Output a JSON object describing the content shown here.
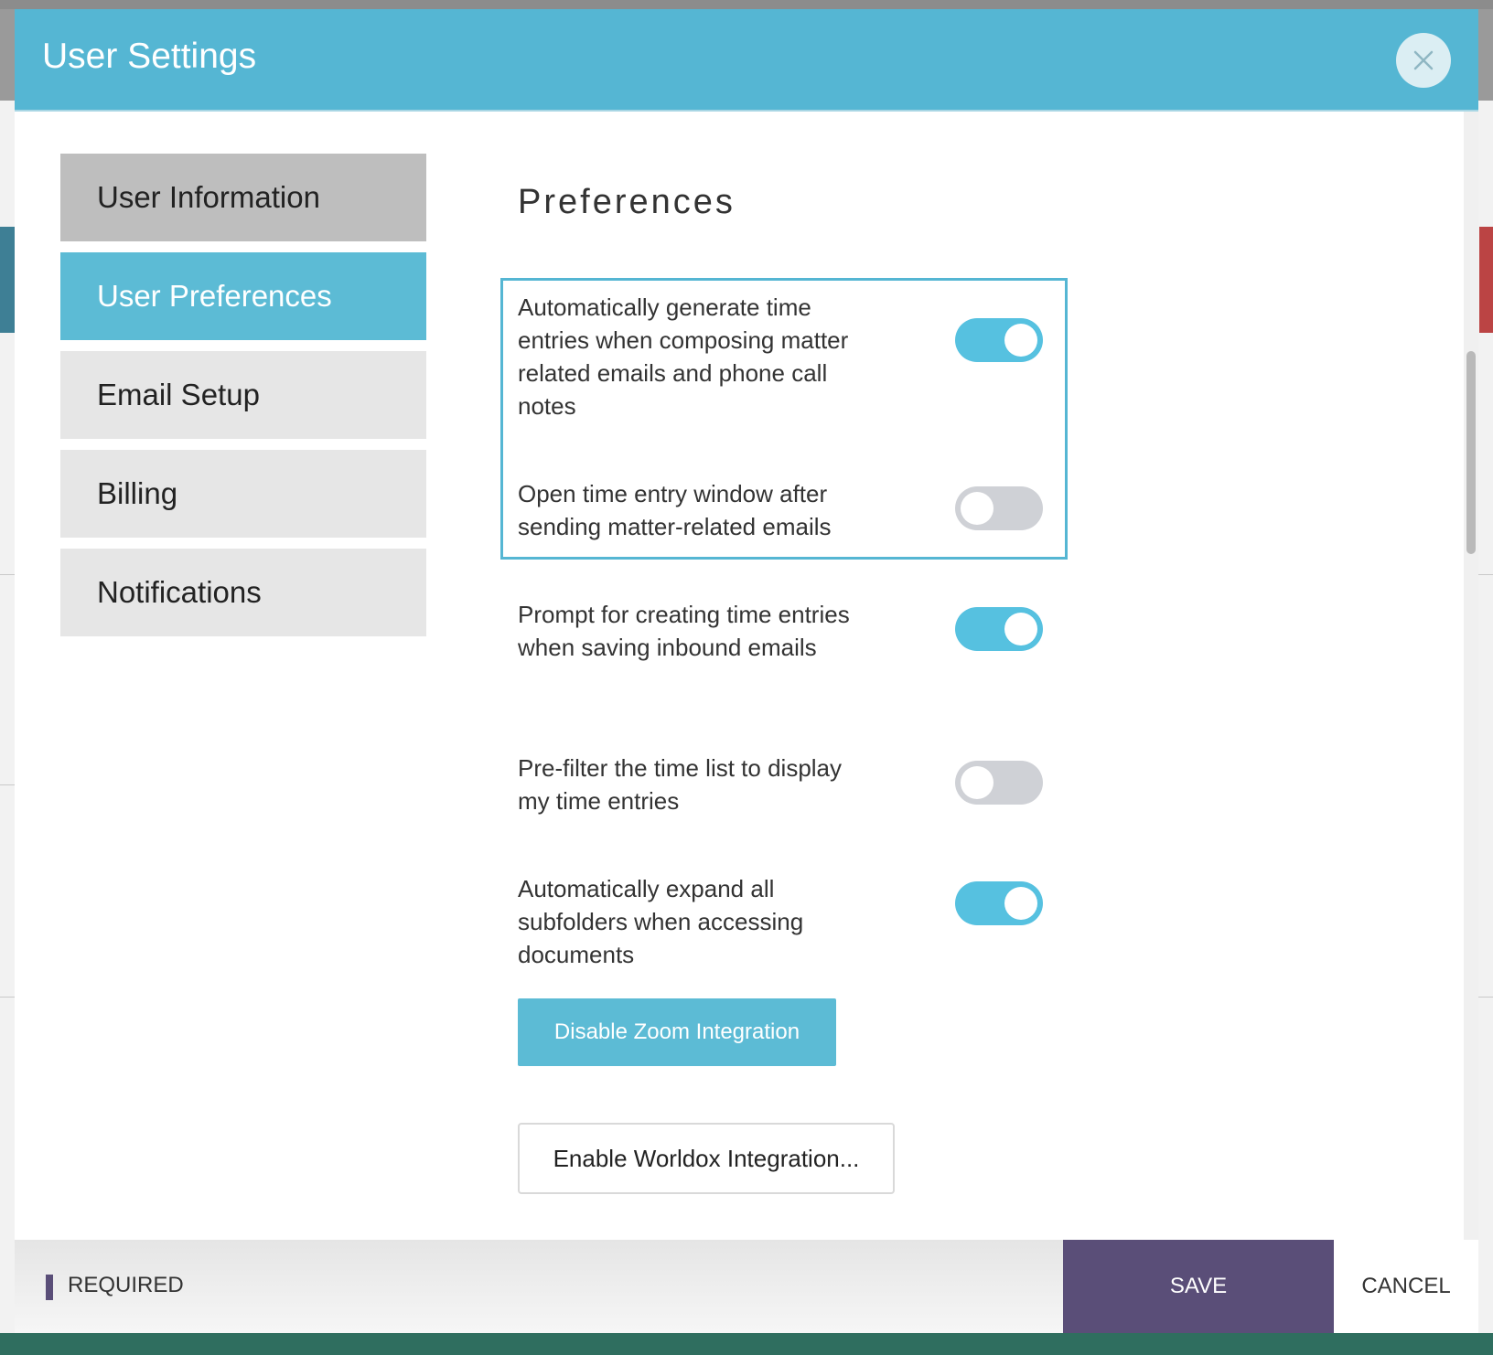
{
  "modal": {
    "title": "User Settings",
    "close_icon": "close-icon"
  },
  "sidebar": {
    "items": [
      {
        "label": "User Information",
        "state": "muted"
      },
      {
        "label": "User Preferences",
        "state": "active"
      },
      {
        "label": "Email Setup",
        "state": "default"
      },
      {
        "label": "Billing",
        "state": "default"
      },
      {
        "label": "Notifications",
        "state": "default"
      }
    ]
  },
  "content": {
    "section_title": "Preferences",
    "preferences": [
      {
        "label": "Automatically generate time entries when composing matter related emails and phone call notes",
        "enabled": true
      },
      {
        "label": "Open time entry window after sending matter-related emails",
        "enabled": false
      },
      {
        "label": "Prompt for creating time entries when saving inbound emails",
        "enabled": true
      },
      {
        "label": "Pre-filter the time list to display my time entries",
        "enabled": false
      },
      {
        "label": "Automatically expand all subfolders when accessing documents",
        "enabled": true
      }
    ],
    "zoom_button_label": "Disable Zoom Integration",
    "worldox_button_label": "Enable Worldox Integration..."
  },
  "footer": {
    "required_label": "REQUIRED",
    "save_label": "SAVE",
    "cancel_label": "CANCEL"
  },
  "colors": {
    "header": "#55b6d3",
    "active_nav": "#5cbbd5",
    "toggle_on": "#56c1e0",
    "toggle_off": "#cfd1d6",
    "save": "#5a4e78"
  }
}
